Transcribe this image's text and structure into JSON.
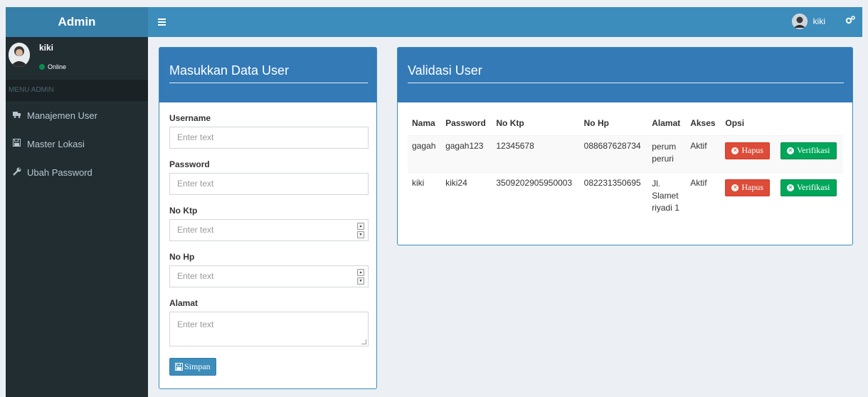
{
  "app": {
    "logo": "Admin"
  },
  "header": {
    "user_name": "kiki",
    "menu_icon": "hamburger-icon",
    "gear_icon": "gears-icon"
  },
  "sidebar": {
    "user": {
      "name": "kiki",
      "status": "Online"
    },
    "section_header": "MENU ADMIN",
    "items": [
      {
        "icon": "truck-icon",
        "label": "Manajemen User"
      },
      {
        "icon": "save-icon",
        "label": "Master Lokasi"
      },
      {
        "icon": "wrench-icon",
        "label": "Ubah Password"
      }
    ]
  },
  "form_box": {
    "title": "Masukkan Data User",
    "fields": [
      {
        "label": "Username",
        "placeholder": "Enter text"
      },
      {
        "label": "Password",
        "placeholder": "Enter text"
      },
      {
        "label": "No Ktp",
        "placeholder": "Enter text"
      },
      {
        "label": "No Hp",
        "placeholder": "Enter text"
      },
      {
        "label": "Alamat",
        "placeholder": "Enter text"
      }
    ],
    "submit_label": "Simpan"
  },
  "validasi_box": {
    "title": "Validasi User",
    "columns": [
      "Nama",
      "Password",
      "No Ktp",
      "No Hp",
      "Alamat",
      "Akses",
      "Opsi"
    ],
    "rows": [
      {
        "nama": "gagah",
        "password": "gagah123",
        "ktp": "12345678",
        "hp": "088687628734",
        "alamat_lines": [
          "perum",
          "peruri"
        ],
        "akses": "Aktif"
      },
      {
        "nama": "kiki",
        "password": "kiki24",
        "ktp": "3509202905950003",
        "hp": "082231350695",
        "alamat_lines": [
          "Jl.",
          "Slamet",
          "riyadi 1"
        ],
        "akses": "Aktif"
      }
    ],
    "hapus_label": "Hapus",
    "verifikasi_label": "Verifikasi"
  },
  "colors": {
    "header": "#3c8dbc",
    "logo": "#367fa9",
    "sidebar": "#222d32",
    "box_header": "#337ab7",
    "danger": "#dd4b39",
    "success": "#00a65a"
  }
}
